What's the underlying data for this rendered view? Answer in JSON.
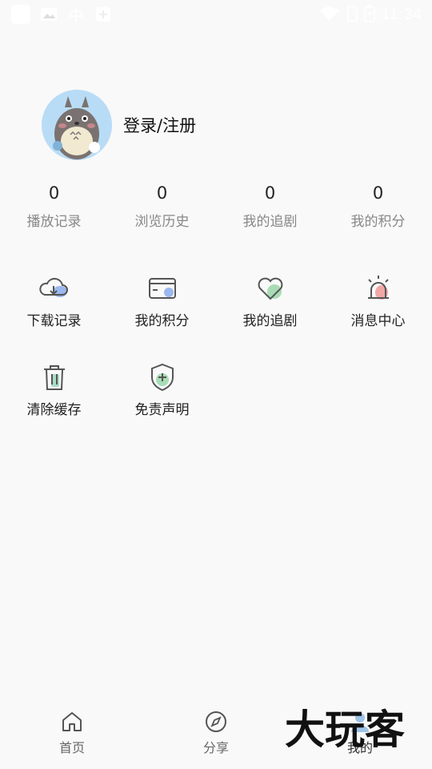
{
  "status_bar": {
    "time": "11:34"
  },
  "profile": {
    "login_label": "登录/注册"
  },
  "stats": [
    {
      "value": "0",
      "label": "播放记录"
    },
    {
      "value": "0",
      "label": "浏览历史"
    },
    {
      "value": "0",
      "label": "我的追剧"
    },
    {
      "value": "0",
      "label": "我的积分"
    }
  ],
  "menu": [
    {
      "label": "下载记录",
      "icon": "cloud-download-icon"
    },
    {
      "label": "我的积分",
      "icon": "card-icon"
    },
    {
      "label": "我的追剧",
      "icon": "heart-icon"
    },
    {
      "label": "消息中心",
      "icon": "alarm-bell-icon"
    },
    {
      "label": "清除缓存",
      "icon": "trash-icon"
    },
    {
      "label": "免责声明",
      "icon": "shield-icon"
    }
  ],
  "bottom_nav": [
    {
      "label": "首页",
      "icon": "home-icon"
    },
    {
      "label": "分享",
      "icon": "compass-icon"
    },
    {
      "label": "我的",
      "icon": "user-icon",
      "active": true
    }
  ],
  "watermark": {
    "text": "大玩客"
  },
  "colors": {
    "background": "#f9f9f9",
    "accent_blue": "#9bb8ef",
    "accent_green": "#a9dcb5",
    "accent_pink": "#f2a7a7"
  }
}
